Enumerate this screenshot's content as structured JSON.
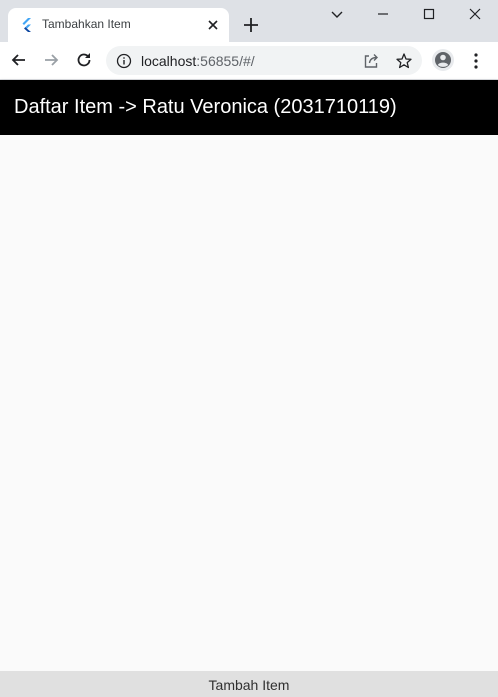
{
  "browser": {
    "tab": {
      "title": "Tambahkan Item",
      "favicon": "flutter-logo-icon"
    },
    "address_bar": {
      "host": "localhost",
      "rest": ":56855/#/"
    },
    "icons": {
      "back": "back-arrow-icon",
      "forward": "forward-arrow-icon",
      "reload": "reload-icon",
      "share": "share-icon",
      "bookmark": "star-icon",
      "profile": "profile-icon",
      "menu": "kebab-menu-icon"
    }
  },
  "app": {
    "appbar_title": "Daftar Item -> Ratu Veronica (2031710119)",
    "bottom_button_label": "Tambah Item"
  },
  "colors": {
    "appbar_bg": "#000000",
    "appbar_text": "#ffffff",
    "page_bg": "#fafafa",
    "bottom_button_bg": "#e0e0e0"
  }
}
